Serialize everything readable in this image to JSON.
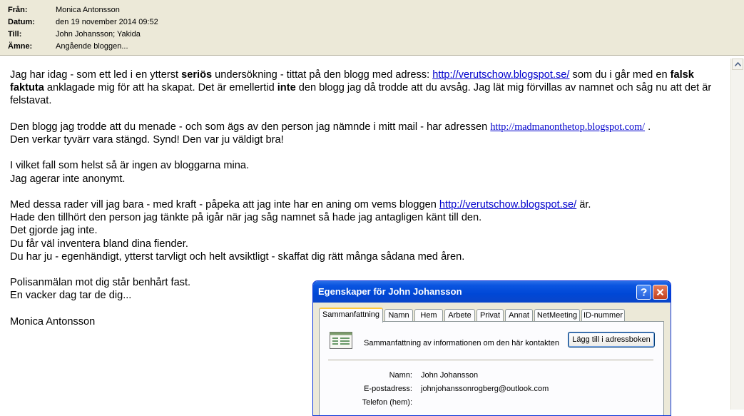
{
  "email_header": {
    "from_label": "Från:",
    "from_value": "Monica Antonsson",
    "date_label": "Datum:",
    "date_value": "den 19 november 2014 09:52",
    "to_label": "Till:",
    "to_value": "John Johansson; Yakida",
    "subject_label": "Ämne:",
    "subject_value": "Angående bloggen..."
  },
  "message": {
    "p1_a": "Jag har idag - som ett led i en ytterst ",
    "p1_b": "seriös",
    "p1_c": " undersökning - tittat på den blogg med adress: ",
    "p1_link": "http://verutschow.blogspot.se/",
    "p1_d": " som du i går med en ",
    "p1_e": "falsk faktuta",
    "p1_f": " anklagade mig för att ha skapat. Det är emellertid ",
    "p1_g": "inte",
    "p1_h": " den blogg jag då trodde att du avsåg. Jag lät mig förvillas av namnet och såg nu att det är felstavat.",
    "p2_a": "Den blogg jag trodde att du menade - och som ägs av den person jag nämnde i mitt mail - har adressen ",
    "p2_link": "http://madmanonthetop.blogspot.com/",
    "p2_b": " .",
    "p2_c": "Den verkar tyvärr vara stängd. Synd! Den var ju väldigt bra!",
    "p3_a": "I vilket fall som helst så är ingen av bloggarna mina.",
    "p3_b": "Jag agerar inte anonymt.",
    "p4_a": "Med dessa rader vill jag bara - med kraft - påpeka att jag inte har en aning om vems bloggen ",
    "p4_link": "http://verutschow.blogspot.se/",
    "p4_b": " är.",
    "p4_c": "Hade den tillhört den person jag tänkte på igår när jag såg namnet så hade jag antagligen känt till den.",
    "p4_d": "Det gjorde jag inte.",
    "p4_e": "Du får väl inventera bland dina fiender.",
    "p4_f": "Du har ju - egenhändigt, ytterst tarvligt och helt avsiktligt - skaffat dig rätt många sådana med åren.",
    "p5_a": "Polisanmälan mot dig står benhårt fast.",
    "p5_b": "En vacker dag tar de dig...",
    "signature": "Monica Antonsson"
  },
  "dialog": {
    "title": "Egenskaper för John Johansson",
    "tabs": [
      "Sammanfattning",
      "Namn",
      "Hem",
      "Arbete",
      "Privat",
      "Annat",
      "NetMeeting",
      "ID-nummer"
    ],
    "summary_text": "Sammanfattning av informationen om den här kontakten",
    "add_button": "Lägg till i adressboken",
    "name_label": "Namn:",
    "name_value": "John Johansson",
    "email_label": "E-postadress:",
    "email_value": "johnjohanssonrogberg@outlook.com",
    "phone_label": "Telefon (hem):"
  },
  "colors": {
    "link": "#0000cc",
    "header_bg": "#ece9d8",
    "titlebar": "#0047d6"
  },
  "icons": {
    "scroll_up": "chevron-up-icon",
    "help": "help-icon",
    "close": "close-icon",
    "contact": "contact-card-icon"
  }
}
